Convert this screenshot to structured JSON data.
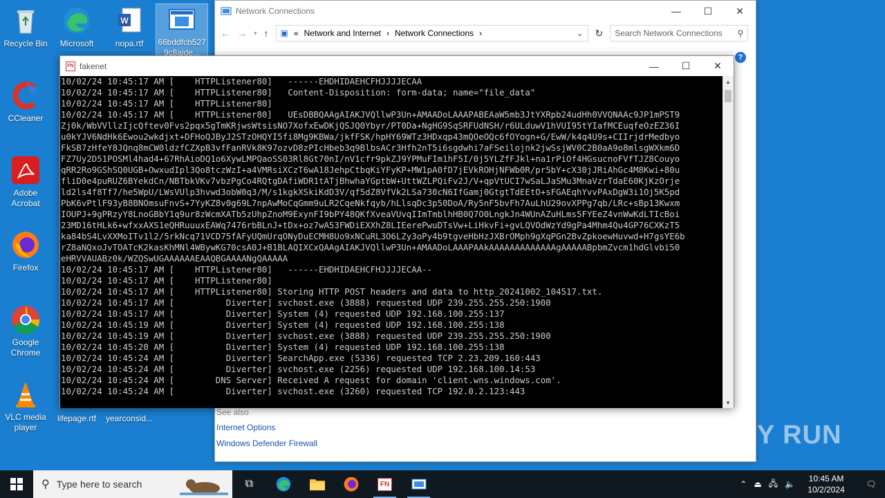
{
  "desktop": {
    "icons": [
      {
        "label": "Recycle Bin",
        "icon": "recycle-bin-icon"
      },
      {
        "label": "Microsoft Edge",
        "icon": "edge-icon"
      },
      {
        "label": "nopa.rtf",
        "icon": "word-doc-icon"
      },
      {
        "label": "66bddfcb5279c8aide...",
        "icon": "file-icon"
      },
      {
        "label": "CCleaner",
        "icon": "ccleaner-icon"
      },
      {
        "label": "Adobe Acrobat",
        "icon": "acrobat-icon"
      },
      {
        "label": "Firefox",
        "icon": "firefox-icon"
      },
      {
        "label": "Google Chrome",
        "icon": "chrome-icon"
      },
      {
        "label": "VLC media player",
        "icon": "vlc-icon"
      },
      {
        "label": "lifepage.rtf",
        "icon": "word-doc-icon"
      },
      {
        "label": "yearconsid...",
        "icon": "word-doc-icon"
      }
    ]
  },
  "explorer": {
    "title": "Network Connections",
    "breadcrumb": [
      "«",
      "Network and Internet",
      "Network Connections"
    ],
    "search_placeholder": "Search Network Connections",
    "see_also": "See also",
    "links": [
      "Internet Options",
      "Windows Defender Firewall"
    ]
  },
  "console": {
    "title": "fakenet",
    "lines": [
      "10/02/24 10:45:17 AM [    HTTPListener80]   ------EHDHIDAEHCFHJJJJECAA",
      "10/02/24 10:45:17 AM [    HTTPListener80]   Content-Disposition: form-data; name=\"file_data\"",
      "10/02/24 10:45:17 AM [    HTTPListener80]",
      "10/02/24 10:45:17 AM [    HTTPListener80]   UEsDBBQAAgAIAKJVQllwP3Un+AMAADoLAAAPABEAaW5mb3JtYXRpb24udHh0VVQNAAc9JP1mPST9",
      "Zj0k/WbVVllzIjcQftev0Fvs2pqx5gTmKRjwsWtsisNO7XofxEwDKjQSJQ0Ybyr/PT0Da+NgHG9SqSRFUdNSH/r6ULduwV1hVUI95tYIafMCEuqfeOzEZ36I",
      "u0kYJV6NdHk6Ewou2wkdjxt+DFHoQJByJ2STzOHQYI5fi8Mg9KBWa/jkfFSK/hpHY69WTz3HDxqp43mQOeOQc6fOYogn+G/EwW/k4q4U9s+CIIrjdrMedbyo",
      "FkSB7zHfeY8JQnq8mCW0ldzfCZXpB3vfFanRVk8K97ozvD8zPIcHbeb3q9BlbsACr3Hfh2nT5i6sgdwhi7aFSeilojnk2jwSsjWV0C2B0aA9o8mlsgWXkm6D",
      "FZ7Uy2D51POSMl4had4+67RhAioDQ1o6XywLMPQaoSS03Rl8Gt70nI/nV1cfr9pkZJ9YPMuFIm1hF5I/0j5YLZfFJkl+na1rPiOf4HGsucnoFVfTJZ8Couyo",
      "qRR2Ro9GShSQ0UGB+OwxudIpl3Qo8tczWzI+a4VMRsiXCzT6wA18JehpCtbqKiYFyKP+MW1pA0fD7jEVkROHjNFWb0R/pr5bY+cX30jJRiAhGc4M8Kwi+80u",
      "fliD0e4puRUZ6BYekdCn/NBTbkVKv7vbzPgCo4RQtgDAfiWDR1tATjBhwhaYGptbW+UttWZLPQiFv2J/V+qpVtUCI7wSaLJaSMu3MnaVzrTdaE60KjKzOrje",
      "ld2ls4f8Tf7/he5WpU/LWsVUlp3hvwd3obW0q3/M/s1kgkXSkiKdD3V/qf5dZ8VfVk2LSa730cN6IfGamj0GtgtTdEEtO+sFGAEqhYvvPAxDgW3i1Oj5K5pd",
      "PbK6vPtlF93yB8BNOmsuFnvS+7YyKZ8v0g69L7npAwMoCqGmm9uLR2CqeNkfqyb/hLlsqDc3p50DoA/Ry5nF5bvFh7AuLhU29ovXPPg7qb/LRc+sBp13Kwxm",
      "IOUPJ+9gPRzyY8LnoGBbY1q9ur8zWcmXATb5zUhpZnoM9ExynFI9bPY48QKfXveaVUvqIImTmblhHB0Q7O0LngkJn4WUnAZuHLms5FYEeZ4vnWwKdLTIcBoi",
      "23MD16tHLk6+wfxxAXS1eQHRuuuxEAWq7476rbBLnJ+tDx+oz7wA53FWDiEXXhZ8LIEerePwuDTsVw+LiHkvFi+gvLQVOdWzYd9gPa4Mhm4Qu4GP76CXKzT5",
      "ka84bS4LvXXMoITv1l2/5rkNcq71VCD75fAFyUQmUrqONyDuECMH8Uo9xNCuRL3O6LZy3oPy4b9tgveHbHzJXBrOMph9gXqPGn2BvZpkoewHuvwd+H7gsYE6b",
      "rZ8aNQxoJvTOATcK2kasKhMNl4WBywKG70csA0J+B1BLAQIXCxQAAgAIAKJVQllwP3Un+AMAADoLAAAPAAkAAAAAAAAAAAAAgAAAAABpbmZvcm1hdGlvbi50",
      "eHRVVAUABz0k/WZQSwUGAAAAAAEAAQBGAAAANgQAAAAA",
      "10/02/24 10:45:17 AM [    HTTPListener80]   ------EHDHIDAEHCFHJJJJECAA--",
      "10/02/24 10:45:17 AM [    HTTPListener80]",
      "10/02/24 10:45:17 AM [    HTTPListener80] Storing HTTP POST headers and data to http_20241002_104517.txt.",
      "10/02/24 10:45:17 AM [          Diverter] svchost.exe (3888) requested UDP 239.255.255.250:1900",
      "10/02/24 10:45:17 AM [          Diverter] System (4) requested UDP 192.168.100.255:137",
      "10/02/24 10:45:19 AM [          Diverter] System (4) requested UDP 192.168.100.255:138",
      "10/02/24 10:45:19 AM [          Diverter] svchost.exe (3888) requested UDP 239.255.255.250:1900",
      "10/02/24 10:45:20 AM [          Diverter] System (4) requested UDP 192.168.100.255:138",
      "10/02/24 10:45:24 AM [          Diverter] SearchApp.exe (5336) requested TCP 2.23.209.160:443",
      "10/02/24 10:45:24 AM [          Diverter] svchost.exe (2256) requested UDP 192.168.100.14:53",
      "10/02/24 10:45:24 AM [        DNS Server] Received A request for domain 'client.wns.windows.com'.",
      "10/02/24 10:45:24 AM [          Diverter] svchost.exe (3260) requested TCP 192.0.2.123:443"
    ]
  },
  "taskbar": {
    "search_placeholder": "Type here to search",
    "time": "10:45 AM",
    "date": "10/2/2024",
    "fn_label": "FN"
  },
  "watermark": "ANY RUN"
}
